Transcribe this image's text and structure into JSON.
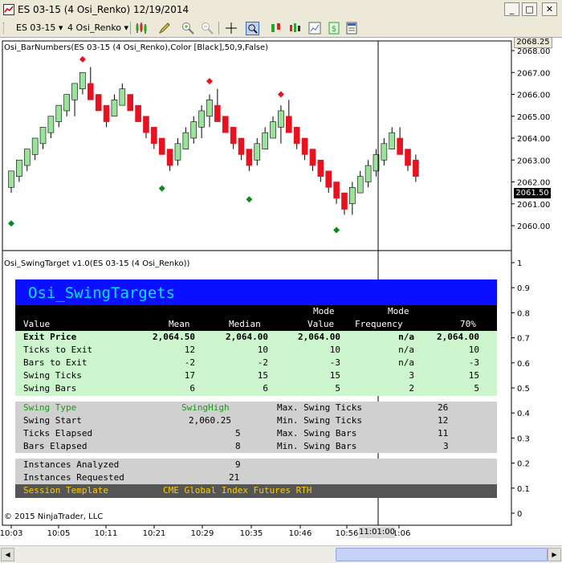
{
  "window": {
    "title": "ES 03-15 (4 Osi_Renko)  12/19/2014",
    "min_btn": "_",
    "max_btn": "□",
    "close_btn": "✕"
  },
  "toolbar": {
    "instrument": "ES 03-15",
    "period": "4 Osi_Renko",
    "arrow": "▾"
  },
  "price_panel": {
    "indicator_label": "Osi_BarNumbers(ES 03-15 (4 Osi_Renko),Color [Black],50,9,False)",
    "top_price_tag": "2068.25",
    "last_price_tag": "2061.50",
    "y_ticks": [
      "2068.00",
      "2067.00",
      "2066.00",
      "2065.00",
      "2064.00",
      "2063.00",
      "2062.00",
      "2061.00",
      "2060.00"
    ],
    "up_color": "#9be39b",
    "down_color": "#e8121f",
    "wick_color": "#000000",
    "marker_high_color": "#e8121f",
    "marker_low_color": "#0a8a1e"
  },
  "chart_data": {
    "type": "candlestick",
    "ylim": [
      2059.5,
      2068.4
    ],
    "bars": [
      {
        "o": 2061.75,
        "c": 2062.5,
        "h": 2062.5,
        "l": 2061.5
      },
      {
        "o": 2062.25,
        "c": 2063.0,
        "h": 2063.0,
        "l": 2062.0
      },
      {
        "o": 2062.75,
        "c": 2063.5,
        "h": 2063.5,
        "l": 2062.5
      },
      {
        "o": 2063.25,
        "c": 2064.0,
        "h": 2064.0,
        "l": 2063.0
      },
      {
        "o": 2063.75,
        "c": 2064.5,
        "h": 2064.5,
        "l": 2063.5
      },
      {
        "o": 2064.25,
        "c": 2065.0,
        "h": 2065.0,
        "l": 2064.0
      },
      {
        "o": 2064.75,
        "c": 2065.5,
        "h": 2065.5,
        "l": 2064.5
      },
      {
        "o": 2065.25,
        "c": 2066.0,
        "h": 2066.0,
        "l": 2065.0
      },
      {
        "o": 2065.75,
        "c": 2066.5,
        "h": 2066.5,
        "l": 2065.0
      },
      {
        "o": 2066.25,
        "c": 2067.0,
        "h": 2067.0,
        "l": 2066.0
      },
      {
        "o": 2066.5,
        "c": 2065.75,
        "h": 2067.25,
        "l": 2065.75
      },
      {
        "o": 2066.0,
        "c": 2065.25,
        "h": 2066.0,
        "l": 2065.25
      },
      {
        "o": 2065.5,
        "c": 2064.75,
        "h": 2065.5,
        "l": 2064.5
      },
      {
        "o": 2065.0,
        "c": 2065.75,
        "h": 2066.0,
        "l": 2065.0
      },
      {
        "o": 2065.5,
        "c": 2066.25,
        "h": 2066.5,
        "l": 2065.5
      },
      {
        "o": 2066.0,
        "c": 2065.25,
        "h": 2066.0,
        "l": 2065.25
      },
      {
        "o": 2065.5,
        "c": 2064.75,
        "h": 2065.5,
        "l": 2064.75
      },
      {
        "o": 2065.0,
        "c": 2064.25,
        "h": 2065.0,
        "l": 2064.0
      },
      {
        "o": 2064.5,
        "c": 2063.75,
        "h": 2064.5,
        "l": 2063.5
      },
      {
        "o": 2064.0,
        "c": 2063.25,
        "h": 2064.0,
        "l": 2063.25
      },
      {
        "o": 2063.5,
        "c": 2062.75,
        "h": 2063.5,
        "l": 2062.5
      },
      {
        "o": 2063.0,
        "c": 2063.75,
        "h": 2064.0,
        "l": 2062.75
      },
      {
        "o": 2063.5,
        "c": 2064.25,
        "h": 2064.5,
        "l": 2063.5
      },
      {
        "o": 2064.0,
        "c": 2064.75,
        "h": 2065.0,
        "l": 2063.75
      },
      {
        "o": 2064.5,
        "c": 2065.25,
        "h": 2065.5,
        "l": 2064.0
      },
      {
        "o": 2065.0,
        "c": 2065.75,
        "h": 2066.0,
        "l": 2064.5
      },
      {
        "o": 2065.5,
        "c": 2064.75,
        "h": 2066.25,
        "l": 2064.75
      },
      {
        "o": 2065.0,
        "c": 2064.25,
        "h": 2065.0,
        "l": 2064.25
      },
      {
        "o": 2064.5,
        "c": 2063.75,
        "h": 2064.5,
        "l": 2063.5
      },
      {
        "o": 2064.0,
        "c": 2063.25,
        "h": 2064.0,
        "l": 2063.0
      },
      {
        "o": 2063.5,
        "c": 2062.75,
        "h": 2063.5,
        "l": 2062.5
      },
      {
        "o": 2063.0,
        "c": 2063.75,
        "h": 2064.0,
        "l": 2062.75
      },
      {
        "o": 2063.5,
        "c": 2064.25,
        "h": 2064.5,
        "l": 2063.5
      },
      {
        "o": 2064.0,
        "c": 2064.75,
        "h": 2065.0,
        "l": 2064.0
      },
      {
        "o": 2064.5,
        "c": 2065.25,
        "h": 2065.5,
        "l": 2063.75
      },
      {
        "o": 2065.0,
        "c": 2064.25,
        "h": 2065.75,
        "l": 2064.25
      },
      {
        "o": 2064.5,
        "c": 2063.75,
        "h": 2064.5,
        "l": 2063.5
      },
      {
        "o": 2064.0,
        "c": 2063.25,
        "h": 2064.0,
        "l": 2063.0
      },
      {
        "o": 2063.5,
        "c": 2062.75,
        "h": 2063.5,
        "l": 2062.5
      },
      {
        "o": 2063.0,
        "c": 2062.25,
        "h": 2063.0,
        "l": 2062.0
      },
      {
        "o": 2062.5,
        "c": 2061.75,
        "h": 2062.5,
        "l": 2061.5
      },
      {
        "o": 2062.0,
        "c": 2061.25,
        "h": 2062.0,
        "l": 2061.0
      },
      {
        "o": 2061.5,
        "c": 2060.75,
        "h": 2061.5,
        "l": 2060.5
      },
      {
        "o": 2061.0,
        "c": 2061.75,
        "h": 2062.0,
        "l": 2060.5
      },
      {
        "o": 2061.5,
        "c": 2062.25,
        "h": 2062.5,
        "l": 2061.5
      },
      {
        "o": 2062.0,
        "c": 2062.75,
        "h": 2063.0,
        "l": 2061.75
      },
      {
        "o": 2062.5,
        "c": 2063.25,
        "h": 2063.5,
        "l": 2062.25
      },
      {
        "o": 2063.0,
        "c": 2063.75,
        "h": 2064.0,
        "l": 2062.75
      },
      {
        "o": 2063.5,
        "c": 2064.25,
        "h": 2064.5,
        "l": 2063.5
      },
      {
        "o": 2064.0,
        "c": 2063.25,
        "h": 2064.5,
        "l": 2063.25
      },
      {
        "o": 2063.5,
        "c": 2062.75,
        "h": 2063.5,
        "l": 2062.5
      },
      {
        "o": 2063.0,
        "c": 2062.25,
        "h": 2063.25,
        "l": 2062.0
      }
    ],
    "markers": [
      {
        "bar": 0,
        "type": "low",
        "price": 2060.1
      },
      {
        "bar": 9,
        "type": "high",
        "price": 2067.6
      },
      {
        "bar": 19,
        "type": "low",
        "price": 2061.7
      },
      {
        "bar": 25,
        "type": "high",
        "price": 2066.6
      },
      {
        "bar": 30,
        "type": "low",
        "price": 2061.2
      },
      {
        "bar": 34,
        "type": "high",
        "price": 2066.0
      },
      {
        "bar": 41,
        "type": "low",
        "price": 2059.8
      }
    ]
  },
  "target_panel": {
    "indicator_label": "Osi_SwingTarget v1.0(ES 03-15 (4 Osi_Renko))",
    "y_ticks": [
      "1",
      "0.9",
      "0.8",
      "0.7",
      "0.6",
      "0.5",
      "0.4",
      "0.3",
      "0.2",
      "0.1",
      "0"
    ],
    "title": "Osi_SwingTargets",
    "header": {
      "mode": "Mode",
      "value_label": "Value",
      "mean": "Mean",
      "median": "Median",
      "mode_value": "Value",
      "mode_freq": "Frequency",
      "pct70": "70%"
    },
    "rows": [
      {
        "label": "Exit Price",
        "mean": "2,064.50",
        "median": "2,064.00",
        "mode": "2,064.00",
        "freq": "n/a",
        "p70": "2,064.00",
        "bold": true
      },
      {
        "label": "Ticks to Exit",
        "mean": "12",
        "median": "10",
        "mode": "10",
        "freq": "n/a",
        "p70": "10"
      },
      {
        "label": "Bars to Exit",
        "mean": "-2",
        "median": "-2",
        "mode": "-3",
        "freq": "n/a",
        "p70": "-3"
      },
      {
        "label": "Swing Ticks",
        "mean": "17",
        "median": "15",
        "mode": "15",
        "freq": "3",
        "p70": "15"
      },
      {
        "label": "Swing Bars",
        "mean": "6",
        "median": "6",
        "mode": "5",
        "freq": "2",
        "p70": "5"
      }
    ],
    "swing": {
      "type_label": "Swing Type",
      "type_value": "SwingHigh",
      "start_label": "Swing Start",
      "start_value": "2,060.25",
      "ticks_el_label": "Ticks Elapsed",
      "ticks_el_value": "5",
      "bars_el_label": "Bars Elapsed",
      "bars_el_value": "8",
      "max_ticks_label": "Max. Swing Ticks",
      "max_ticks_value": "26",
      "min_ticks_label": "Min. Swing Ticks",
      "min_ticks_value": "12",
      "max_bars_label": "Max. Swing Bars",
      "max_bars_value": "11",
      "min_bars_label": "Min. Swing Bars",
      "min_bars_value": "3"
    },
    "instances": {
      "analyzed_label": "Instances Analyzed",
      "analyzed_value": "9",
      "requested_label": "Instances Requested",
      "requested_value": "21",
      "session_label": "Session Template",
      "session_value": "CME Global Index Futures RTH"
    },
    "colors": {
      "title_bg": "#0a10ff",
      "title_fg": "#00e5ff",
      "header_bg": "#000000",
      "stats_bg": "#cdf5cd",
      "swing_bg": "#d0d0d0",
      "swing_type_fg": "#1a9a1a",
      "session_bg": "#555555",
      "session_fg": "#ffcc00"
    }
  },
  "copyright": "© 2015 NinjaTrader, LLC",
  "time_axis": {
    "labels": [
      "10:03",
      "10:05",
      "10:11",
      "10:21",
      "10:29",
      "10:35",
      "10:46",
      "10:56",
      "11:06"
    ],
    "crosshair_time": "11:01:00"
  }
}
